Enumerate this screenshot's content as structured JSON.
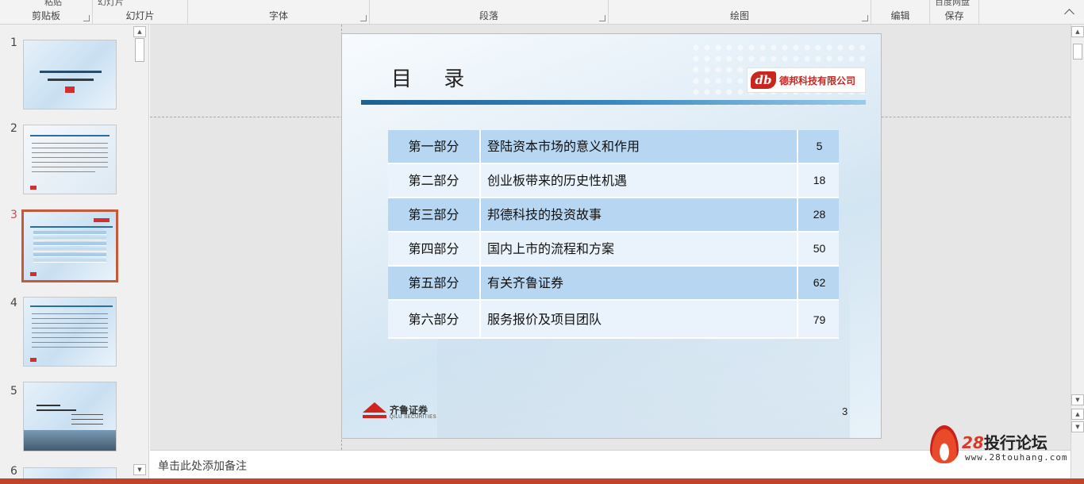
{
  "ribbon": {
    "groups": [
      {
        "label": "剪贴板",
        "partial": "粘贴"
      },
      {
        "label": "幻灯片",
        "partial": "幻灯片"
      },
      {
        "label": "字体",
        "partial": ""
      },
      {
        "label": "段落",
        "partial": ""
      },
      {
        "label": "绘图",
        "partial": ""
      },
      {
        "label": "编辑",
        "partial": ""
      },
      {
        "label": "保存",
        "partial": "百度网盘"
      }
    ]
  },
  "thumbnails": {
    "items": [
      {
        "number": "1"
      },
      {
        "number": "2"
      },
      {
        "number": "3",
        "active": true
      },
      {
        "number": "4"
      },
      {
        "number": "5"
      },
      {
        "number": "6"
      }
    ]
  },
  "slide": {
    "title": "目 录",
    "company_logo_text": "德邦科技有限公司",
    "company_logo_mark": "db",
    "toc": [
      {
        "part": "第一部分",
        "title": "登陆资本市场的意义和作用",
        "page": "5"
      },
      {
        "part": "第二部分",
        "title": "创业板带来的历史性机遇",
        "page": "18"
      },
      {
        "part": "第三部分",
        "title": "邦德科技的投资故事",
        "page": "28"
      },
      {
        "part": "第四部分",
        "title": "国内上市的流程和方案",
        "page": "50"
      },
      {
        "part": "第五部分",
        "title": "有关齐鲁证券",
        "page": "62"
      },
      {
        "part": "第六部分",
        "title": "服务报价及项目团队",
        "page": "79"
      }
    ],
    "footer_logo_name": "齐鲁证券",
    "footer_logo_sub": "QILU SECURITIES",
    "slide_number": "3"
  },
  "notes": {
    "placeholder": "单击此处添加备注"
  },
  "brand": {
    "number": "28",
    "name": "投行论坛",
    "url": "www.28touhang.com"
  },
  "colors": {
    "accent": "#c55a3b",
    "title_bar": "#1e5f91",
    "row_blue": "#b7d6f2",
    "row_light": "#eaf3fb",
    "status_bar": "#c0442a"
  }
}
